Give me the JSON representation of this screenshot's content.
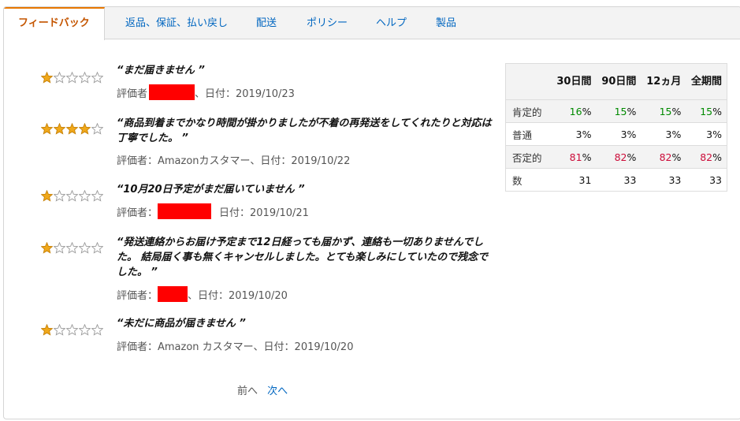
{
  "tabs": [
    {
      "label": "フィードバック",
      "active": true
    },
    {
      "label": "返品、保証、払い戻し",
      "active": false
    },
    {
      "label": "配送",
      "active": false
    },
    {
      "label": "ポリシー",
      "active": false
    },
    {
      "label": "ヘルプ",
      "active": false
    },
    {
      "label": "製品",
      "active": false
    }
  ],
  "reviews": [
    {
      "rating": 1,
      "text": "“まだ届きません ”",
      "meta_prefix": "評価者",
      "meta_suffix": "、日付：2019/10/23"
    },
    {
      "rating": 4,
      "text": "“商品到着までかなり時間が掛かりましたが不着の再発送をしてくれたりと対応は丁寧でした。 ”",
      "meta_prefix": "評価者：Amazonカスタマー、日付：2019/10/22",
      "meta_suffix": ""
    },
    {
      "rating": 1,
      "text": "“10月20日予定がまだ届いていません ”",
      "meta_prefix": "評価者：",
      "meta_suffix": "日付：2019/10/21"
    },
    {
      "rating": 1,
      "text": "“発送連絡からお届け予定まで12日経っても届かず、連絡も一切ありませんでした。 結局届く事も無くキャンセルしました。とても楽しみにしていたので残念でした。 ”",
      "meta_prefix": "評価者：",
      "meta_suffix": "、日付：2019/10/20"
    },
    {
      "rating": 1,
      "text": "“未だに商品が届きません ”",
      "meta_prefix": "評価者：Amazon カスタマー、日付：2019/10/20",
      "meta_suffix": ""
    }
  ],
  "pager": {
    "prev": "前へ",
    "next": "次へ"
  },
  "stats": {
    "headers": [
      "",
      "30日間",
      "90日間",
      "12ヵ月",
      "全期間"
    ],
    "rows": [
      {
        "label": "肯定的",
        "values": [
          "16",
          "15",
          "15",
          "15"
        ],
        "unit": "%",
        "tone": "pos"
      },
      {
        "label": "普通",
        "values": [
          "3",
          "3",
          "3",
          "3"
        ],
        "unit": "%",
        "tone": ""
      },
      {
        "label": "否定的",
        "values": [
          "81",
          "82",
          "82",
          "82"
        ],
        "unit": "%",
        "tone": "neg"
      },
      {
        "label": "数",
        "values": [
          "31",
          "33",
          "33",
          "33"
        ],
        "unit": "",
        "tone": ""
      }
    ]
  },
  "colors": {
    "accent": "#c45500",
    "link": "#0066c0",
    "star": "#f0a81a",
    "redaction": "#ff0000"
  },
  "icons": {
    "star_filled": "star-filled-icon",
    "star_empty": "star-empty-icon"
  }
}
